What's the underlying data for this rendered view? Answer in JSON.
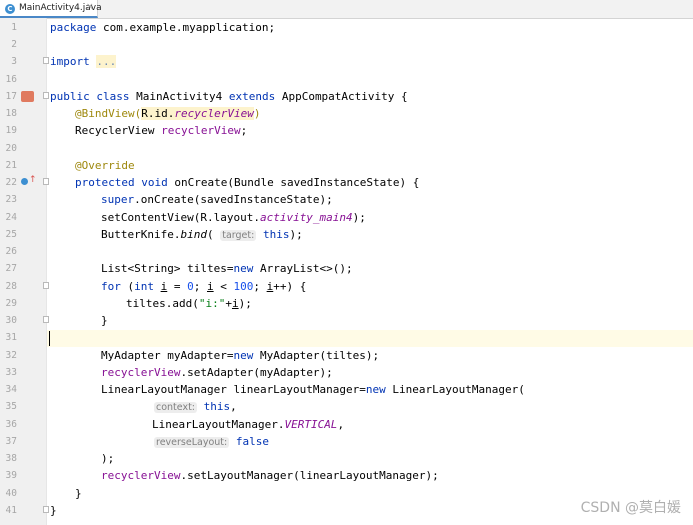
{
  "editor": {
    "tab": {
      "icon": "java-class-icon",
      "label": "MainActivity4.java",
      "close": "×"
    }
  },
  "gutter": {
    "line_numbers": [
      "1",
      "2",
      "3",
      "16",
      "17",
      "18",
      "19",
      "20",
      "21",
      "22",
      "23",
      "24",
      "25",
      "26",
      "27",
      "28",
      "29",
      "30",
      "31",
      "32",
      "33",
      "34",
      "35",
      "36",
      "37",
      "38",
      "39",
      "40",
      "41"
    ]
  },
  "code": {
    "l1_kw": "package",
    "l1_rest": " com.example.myapplication;",
    "l3_kw": "import",
    "l3_fold": "...",
    "l17_kw1": "public",
    "l17_kw2": "class",
    "l17_name": " MainActivity4 ",
    "l17_kw3": "extends",
    "l17_rest": " AppCompatActivity {",
    "l18_ann": "@BindView(",
    "l18_ref_a": "R.id.",
    "l18_ref_b": "recyclerView",
    "l18_close": ")",
    "l19_type": "RecyclerView ",
    "l19_field": "recyclerView",
    "l19_end": ";",
    "l21_ann": "@Override",
    "l22_kw1": "protected",
    "l22_kw2": "void",
    "l22_rest": " onCreate(Bundle savedInstanceState) {",
    "l23_kw": "super",
    "l23_rest": ".onCreate(savedInstanceState);",
    "l24_a": "setContentView(R.layout.",
    "l24_b": "activity_main4",
    "l24_c": ");",
    "l25_a": "ButterKnife.",
    "l25_b": "bind",
    "l25_c": "(",
    "l25_hint": "target:",
    "l25_kw": "this",
    "l25_d": ");",
    "l27_a": "List<String> tiltes=",
    "l27_kw": "new",
    "l27_b": " ArrayList<>();",
    "l28_kw1": "for",
    "l28_a": " (",
    "l28_kw2": "int",
    "l28_i1": "i",
    "l28_b": " = ",
    "l28_n0": "0",
    "l28_c": "; ",
    "l28_i2": "i",
    "l28_d": " < ",
    "l28_n100": "100",
    "l28_e": "; ",
    "l28_i3": "i",
    "l28_f": "++) {",
    "l29_a": "tiltes.add(",
    "l29_str": "\"i:\"",
    "l29_b": "+",
    "l29_i": "i",
    "l29_c": ");",
    "l30": "}",
    "l32_a": "MyAdapter myAdapter=",
    "l32_kw": "new",
    "l32_b": " MyAdapter(tiltes);",
    "l33_f": "recyclerView",
    "l33_b": ".setAdapter(myAdapter);",
    "l34_a": "LinearLayoutManager linearLayoutManager=",
    "l34_kw": "new",
    "l34_b": " LinearLayoutManager(",
    "l35_hint": "context:",
    "l35_kw": "this",
    "l35_b": ",",
    "l36_a": "LinearLayoutManager.",
    "l36_f": "VERTICAL",
    "l36_b": ",",
    "l37_hint": "reverseLayout:",
    "l37_kw": "false",
    "l38": ");",
    "l39_f": "recyclerView",
    "l39_b": ".setLayoutManager(linearLayoutManager);",
    "l40": "}",
    "l41": "}"
  },
  "watermark": "CSDN @莫白媛",
  "colors": {
    "keyword": "#0033b3",
    "annotation": "#9e880d",
    "field": "#871094",
    "string": "#067d17",
    "number": "#1750eb",
    "hint": "#808080"
  }
}
